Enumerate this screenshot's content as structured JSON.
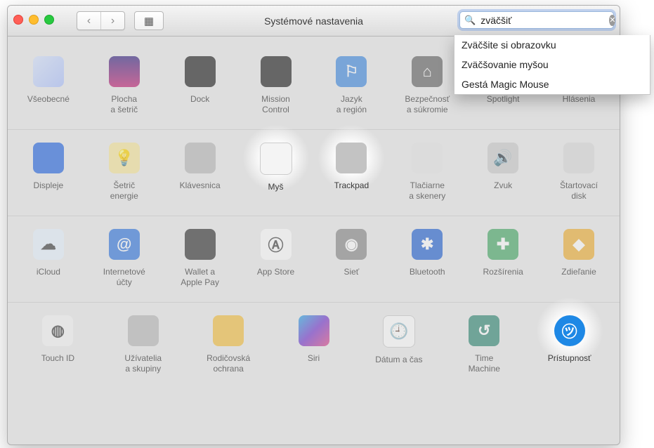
{
  "window": {
    "title": "Systémové nastavenia"
  },
  "search": {
    "value": "zväčšiť"
  },
  "suggestions": [
    "Zväčšite si obrazovku",
    "Zväčšovanie myšou",
    "Gestá Magic Mouse"
  ],
  "rows": [
    [
      {
        "id": "general",
        "label": "Všeobecné",
        "glyph": "",
        "g": "i-general"
      },
      {
        "id": "desktop",
        "label": "Plocha\na šetrič",
        "glyph": "",
        "g": "i-desktop"
      },
      {
        "id": "dock",
        "label": "Dock",
        "glyph": "",
        "g": "i-dock"
      },
      {
        "id": "mission",
        "label": "Mission\nControl",
        "glyph": "",
        "g": "i-mission"
      },
      {
        "id": "language",
        "label": "Jazyk\na región",
        "glyph": "⚐",
        "g": "i-lang"
      },
      {
        "id": "security",
        "label": "Bezpečnosť\na súkromie",
        "glyph": "⌂",
        "g": "i-security"
      },
      {
        "id": "spotlight",
        "label": "Spotlight",
        "glyph": "🔍",
        "g": "i-spotlight"
      },
      {
        "id": "notifications",
        "label": "Hlásenia",
        "glyph": "●",
        "g": "i-notif"
      }
    ],
    [
      {
        "id": "displays",
        "label": "Displeje",
        "glyph": "",
        "g": "i-display"
      },
      {
        "id": "energy",
        "label": "Šetrič\nenergie",
        "glyph": "💡",
        "g": "i-energy",
        "dark": true
      },
      {
        "id": "keyboard",
        "label": "Klávesnica",
        "glyph": "",
        "g": "i-keyboard"
      },
      {
        "id": "mouse",
        "label": "Myš",
        "glyph": "",
        "g": "i-mouse",
        "spot": true
      },
      {
        "id": "trackpad",
        "label": "Trackpad",
        "glyph": "",
        "g": "i-trackpad",
        "spot": true
      },
      {
        "id": "printers",
        "label": "Tlačiarne\na skenery",
        "glyph": "",
        "g": "i-printers"
      },
      {
        "id": "sound",
        "label": "Zvuk",
        "glyph": "🔊",
        "g": "i-sound",
        "dark": true
      },
      {
        "id": "startup",
        "label": "Štartovací\ndisk",
        "glyph": "",
        "g": "i-startup"
      }
    ],
    [
      {
        "id": "icloud",
        "label": "iCloud",
        "glyph": "☁",
        "g": "i-icloud",
        "dark": true
      },
      {
        "id": "accounts",
        "label": "Internetové\núčty",
        "glyph": "@",
        "g": "i-accounts"
      },
      {
        "id": "wallet",
        "label": "Wallet a\nApple Pay",
        "glyph": "",
        "g": "i-wallet"
      },
      {
        "id": "appstore",
        "label": "App Store",
        "glyph": "Ⓐ",
        "g": "i-appstore",
        "dark": true
      },
      {
        "id": "network",
        "label": "Sieť",
        "glyph": "◉",
        "g": "i-network"
      },
      {
        "id": "bluetooth",
        "label": "Bluetooth",
        "glyph": "✱",
        "g": "i-bt"
      },
      {
        "id": "extensions",
        "label": "Rozšírenia",
        "glyph": "✚",
        "g": "i-ext"
      },
      {
        "id": "sharing",
        "label": "Zdieľanie",
        "glyph": "◆",
        "g": "i-share"
      }
    ],
    [
      {
        "id": "touchid",
        "label": "Touch ID",
        "glyph": "◍",
        "g": "i-touch",
        "dark": true
      },
      {
        "id": "users",
        "label": "Užívatelia\na skupiny",
        "glyph": "",
        "g": "i-users"
      },
      {
        "id": "parental",
        "label": "Rodičovská\nochrana",
        "glyph": "",
        "g": "i-parental"
      },
      {
        "id": "siri",
        "label": "Siri",
        "glyph": "",
        "g": "i-siri"
      },
      {
        "id": "date",
        "label": "Dátum a čas",
        "glyph": "🕘",
        "g": "i-date",
        "dark": true
      },
      {
        "id": "timemachine",
        "label": "Time\nMachine",
        "glyph": "↺",
        "g": "i-tm"
      },
      {
        "id": "accessibility",
        "label": "Prístupnosť",
        "glyph": "㋡",
        "g": "i-access",
        "spot": true
      }
    ]
  ]
}
